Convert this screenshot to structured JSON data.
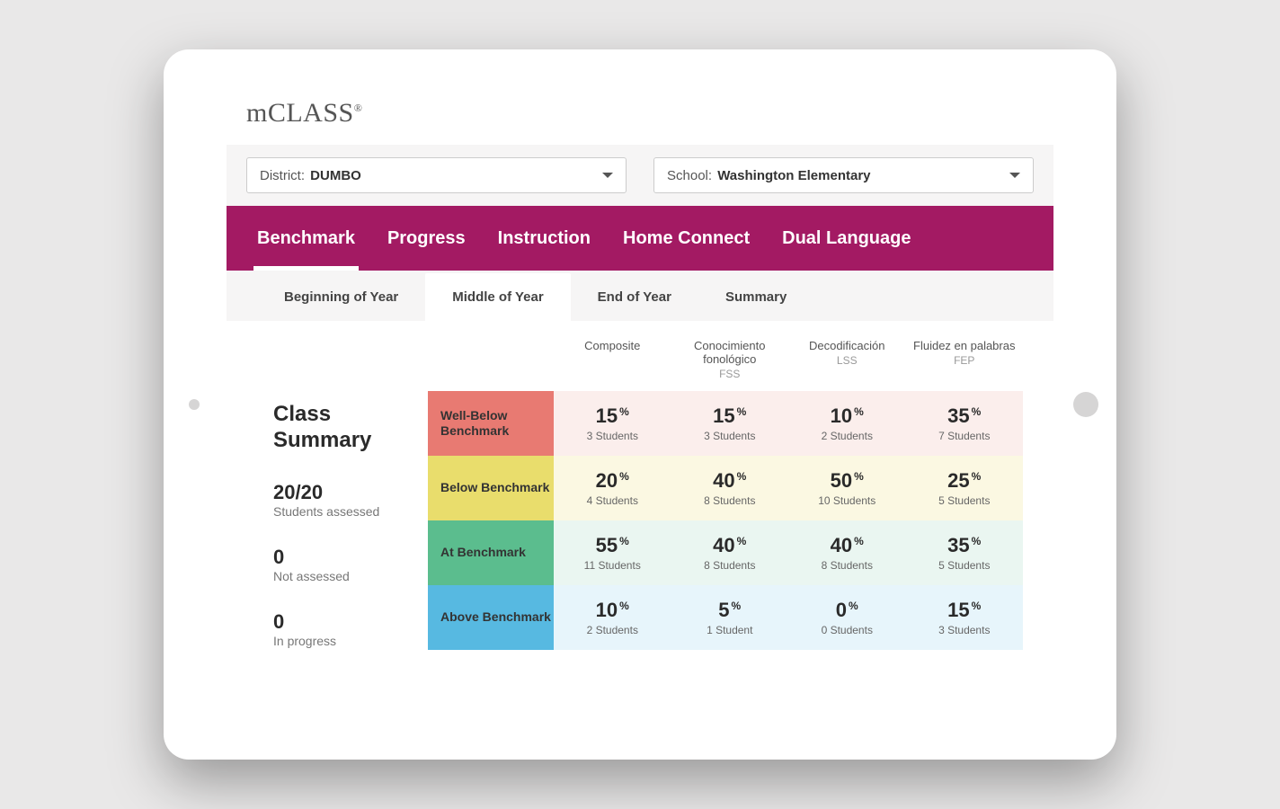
{
  "brand": "mCLASS",
  "brand_sup": "®",
  "selectors": {
    "district": {
      "label": "District: ",
      "value": "DUMBO"
    },
    "school": {
      "label": "School: ",
      "value": "Washington Elementary"
    }
  },
  "nav": {
    "items": [
      "Benchmark",
      "Progress",
      "Instruction",
      "Home Connect",
      "Dual Language"
    ],
    "active": 0
  },
  "subtabs": {
    "items": [
      "Beginning of Year",
      "Middle of Year",
      "End of Year",
      "Summary"
    ],
    "active": 1
  },
  "summary": {
    "title": "Class Summary",
    "stats": [
      {
        "n": "20/20",
        "lbl": "Students assessed"
      },
      {
        "n": "0",
        "lbl": "Not assessed"
      },
      {
        "n": "0",
        "lbl": "In progress"
      }
    ]
  },
  "columns": [
    {
      "title": "Composite",
      "sub": ""
    },
    {
      "title": "Conocimiento fonológico",
      "sub": "FSS"
    },
    {
      "title": "Decodificación",
      "sub": "LSS"
    },
    {
      "title": "Fluidez en palabras",
      "sub": "FEP"
    }
  ],
  "rows": [
    {
      "label": "Well-Below Benchmark",
      "key": "wb",
      "cells": [
        {
          "pct": "15",
          "stu": "3 Students"
        },
        {
          "pct": "15",
          "stu": "3 Students"
        },
        {
          "pct": "10",
          "stu": "2 Students"
        },
        {
          "pct": "35",
          "stu": "7 Students"
        }
      ]
    },
    {
      "label": "Below Benchmark",
      "key": "bb",
      "cells": [
        {
          "pct": "20",
          "stu": "4 Students"
        },
        {
          "pct": "40",
          "stu": "8 Students"
        },
        {
          "pct": "50",
          "stu": "10 Students"
        },
        {
          "pct": "25",
          "stu": "5 Students"
        }
      ]
    },
    {
      "label": "At Benchmark",
      "key": "ab",
      "cells": [
        {
          "pct": "55",
          "stu": "11 Students"
        },
        {
          "pct": "40",
          "stu": "8 Students"
        },
        {
          "pct": "40",
          "stu": "8 Students"
        },
        {
          "pct": "35",
          "stu": "5 Students"
        }
      ]
    },
    {
      "label": "Above Benchmark",
      "key": "av",
      "cells": [
        {
          "pct": "10",
          "stu": "2 Students"
        },
        {
          "pct": "5",
          "stu": "1 Student"
        },
        {
          "pct": "0",
          "stu": "0 Students"
        },
        {
          "pct": "15",
          "stu": "3 Students"
        }
      ]
    }
  ]
}
